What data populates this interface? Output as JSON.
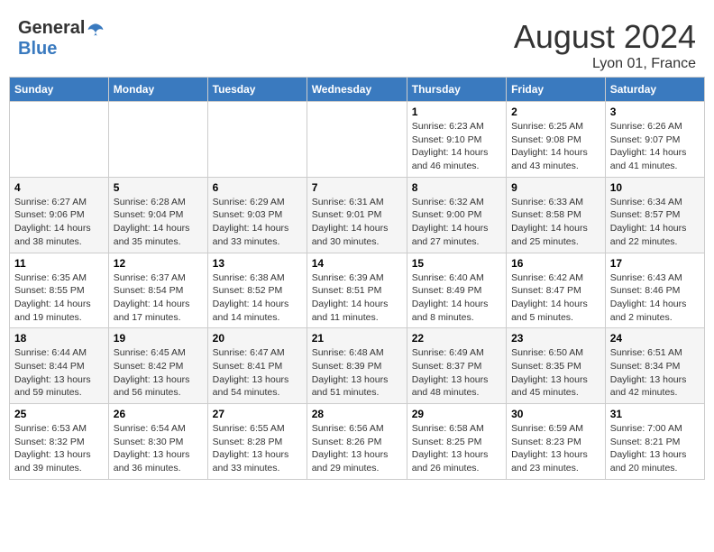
{
  "header": {
    "logo_general": "General",
    "logo_blue": "Blue",
    "month": "August 2024",
    "location": "Lyon 01, France"
  },
  "weekdays": [
    "Sunday",
    "Monday",
    "Tuesday",
    "Wednesday",
    "Thursday",
    "Friday",
    "Saturday"
  ],
  "weeks": [
    [
      {
        "day": "",
        "info": ""
      },
      {
        "day": "",
        "info": ""
      },
      {
        "day": "",
        "info": ""
      },
      {
        "day": "",
        "info": ""
      },
      {
        "day": "1",
        "info": "Sunrise: 6:23 AM\nSunset: 9:10 PM\nDaylight: 14 hours and 46 minutes."
      },
      {
        "day": "2",
        "info": "Sunrise: 6:25 AM\nSunset: 9:08 PM\nDaylight: 14 hours and 43 minutes."
      },
      {
        "day": "3",
        "info": "Sunrise: 6:26 AM\nSunset: 9:07 PM\nDaylight: 14 hours and 41 minutes."
      }
    ],
    [
      {
        "day": "4",
        "info": "Sunrise: 6:27 AM\nSunset: 9:06 PM\nDaylight: 14 hours and 38 minutes."
      },
      {
        "day": "5",
        "info": "Sunrise: 6:28 AM\nSunset: 9:04 PM\nDaylight: 14 hours and 35 minutes."
      },
      {
        "day": "6",
        "info": "Sunrise: 6:29 AM\nSunset: 9:03 PM\nDaylight: 14 hours and 33 minutes."
      },
      {
        "day": "7",
        "info": "Sunrise: 6:31 AM\nSunset: 9:01 PM\nDaylight: 14 hours and 30 minutes."
      },
      {
        "day": "8",
        "info": "Sunrise: 6:32 AM\nSunset: 9:00 PM\nDaylight: 14 hours and 27 minutes."
      },
      {
        "day": "9",
        "info": "Sunrise: 6:33 AM\nSunset: 8:58 PM\nDaylight: 14 hours and 25 minutes."
      },
      {
        "day": "10",
        "info": "Sunrise: 6:34 AM\nSunset: 8:57 PM\nDaylight: 14 hours and 22 minutes."
      }
    ],
    [
      {
        "day": "11",
        "info": "Sunrise: 6:35 AM\nSunset: 8:55 PM\nDaylight: 14 hours and 19 minutes."
      },
      {
        "day": "12",
        "info": "Sunrise: 6:37 AM\nSunset: 8:54 PM\nDaylight: 14 hours and 17 minutes."
      },
      {
        "day": "13",
        "info": "Sunrise: 6:38 AM\nSunset: 8:52 PM\nDaylight: 14 hours and 14 minutes."
      },
      {
        "day": "14",
        "info": "Sunrise: 6:39 AM\nSunset: 8:51 PM\nDaylight: 14 hours and 11 minutes."
      },
      {
        "day": "15",
        "info": "Sunrise: 6:40 AM\nSunset: 8:49 PM\nDaylight: 14 hours and 8 minutes."
      },
      {
        "day": "16",
        "info": "Sunrise: 6:42 AM\nSunset: 8:47 PM\nDaylight: 14 hours and 5 minutes."
      },
      {
        "day": "17",
        "info": "Sunrise: 6:43 AM\nSunset: 8:46 PM\nDaylight: 14 hours and 2 minutes."
      }
    ],
    [
      {
        "day": "18",
        "info": "Sunrise: 6:44 AM\nSunset: 8:44 PM\nDaylight: 13 hours and 59 minutes."
      },
      {
        "day": "19",
        "info": "Sunrise: 6:45 AM\nSunset: 8:42 PM\nDaylight: 13 hours and 56 minutes."
      },
      {
        "day": "20",
        "info": "Sunrise: 6:47 AM\nSunset: 8:41 PM\nDaylight: 13 hours and 54 minutes."
      },
      {
        "day": "21",
        "info": "Sunrise: 6:48 AM\nSunset: 8:39 PM\nDaylight: 13 hours and 51 minutes."
      },
      {
        "day": "22",
        "info": "Sunrise: 6:49 AM\nSunset: 8:37 PM\nDaylight: 13 hours and 48 minutes."
      },
      {
        "day": "23",
        "info": "Sunrise: 6:50 AM\nSunset: 8:35 PM\nDaylight: 13 hours and 45 minutes."
      },
      {
        "day": "24",
        "info": "Sunrise: 6:51 AM\nSunset: 8:34 PM\nDaylight: 13 hours and 42 minutes."
      }
    ],
    [
      {
        "day": "25",
        "info": "Sunrise: 6:53 AM\nSunset: 8:32 PM\nDaylight: 13 hours and 39 minutes."
      },
      {
        "day": "26",
        "info": "Sunrise: 6:54 AM\nSunset: 8:30 PM\nDaylight: 13 hours and 36 minutes."
      },
      {
        "day": "27",
        "info": "Sunrise: 6:55 AM\nSunset: 8:28 PM\nDaylight: 13 hours and 33 minutes."
      },
      {
        "day": "28",
        "info": "Sunrise: 6:56 AM\nSunset: 8:26 PM\nDaylight: 13 hours and 29 minutes."
      },
      {
        "day": "29",
        "info": "Sunrise: 6:58 AM\nSunset: 8:25 PM\nDaylight: 13 hours and 26 minutes."
      },
      {
        "day": "30",
        "info": "Sunrise: 6:59 AM\nSunset: 8:23 PM\nDaylight: 13 hours and 23 minutes."
      },
      {
        "day": "31",
        "info": "Sunrise: 7:00 AM\nSunset: 8:21 PM\nDaylight: 13 hours and 20 minutes."
      }
    ]
  ]
}
